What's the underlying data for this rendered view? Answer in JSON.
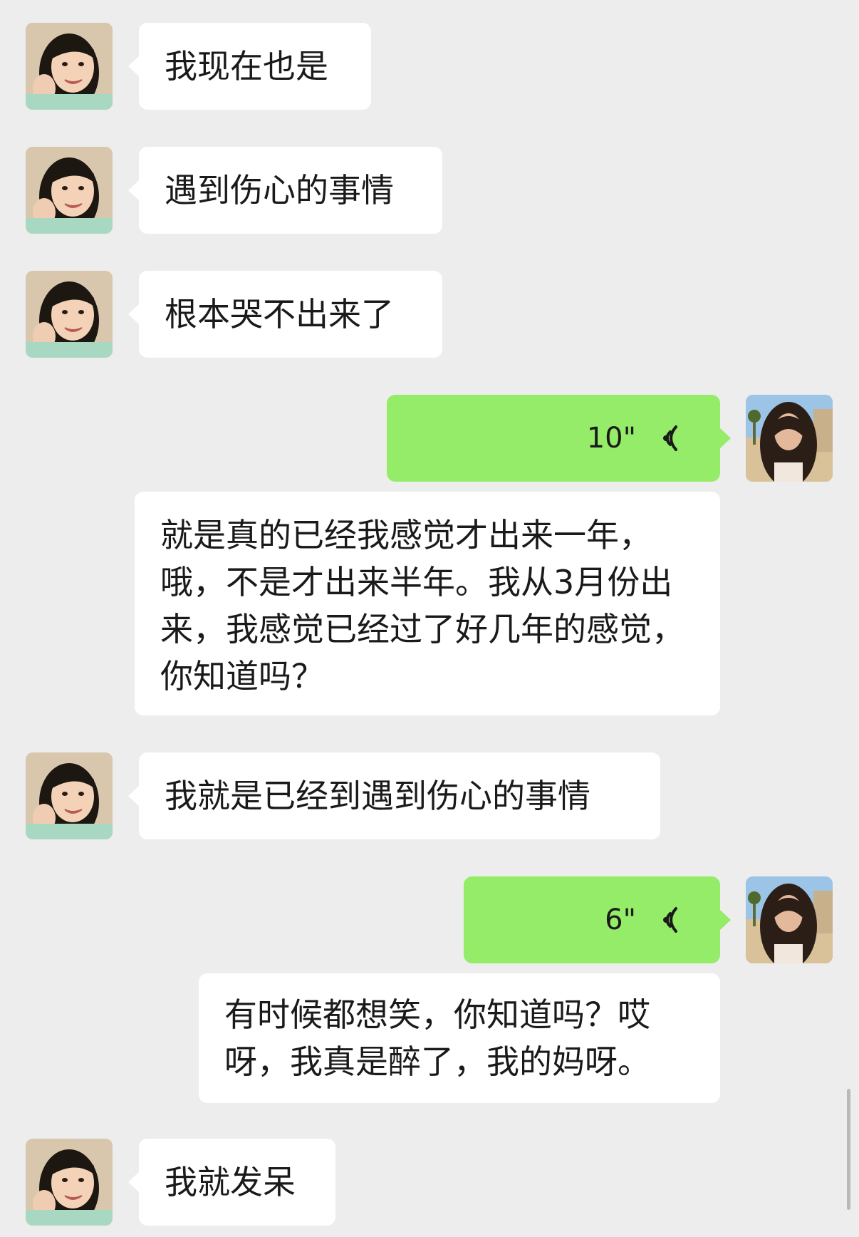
{
  "messages": [
    {
      "side": "left",
      "type": "text",
      "text": "我现在也是"
    },
    {
      "side": "left",
      "type": "text",
      "text": "遇到伤心的事情"
    },
    {
      "side": "left",
      "type": "text",
      "text": "根本哭不出来了"
    },
    {
      "side": "right",
      "type": "voice",
      "duration": "10\"",
      "transcript": "就是真的已经我感觉才出来一年，哦，不是才出来半年。我从3月份出来，我感觉已经过了好几年的感觉，你知道吗？"
    },
    {
      "side": "left",
      "type": "text",
      "text": "我就是已经到遇到伤心的事情"
    },
    {
      "side": "right",
      "type": "voice",
      "duration": "6\"",
      "transcript": "有时候都想笑，你知道吗？哎呀，我真是醉了，我的妈呀。"
    },
    {
      "side": "left",
      "type": "text",
      "text": "我就发呆"
    }
  ],
  "colors": {
    "background": "#ededed",
    "incoming_bubble": "#ffffff",
    "outgoing_bubble": "#95ec69"
  },
  "icons": {
    "voice": "voice-wave-icon",
    "avatar_left": "contact-avatar",
    "avatar_right": "self-avatar"
  }
}
